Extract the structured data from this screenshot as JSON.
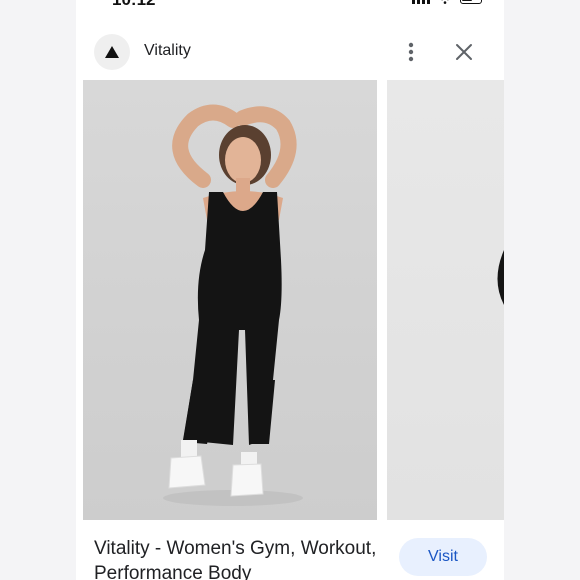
{
  "status_bar": {
    "time": "10:12"
  },
  "header": {
    "site_name": "Vitality",
    "logo_icon": "triangle-logo-icon",
    "more_icon": "more-vert-icon",
    "close_icon": "close-icon"
  },
  "result": {
    "title": "Vitality - Women's Gym, Workout, Performance Body",
    "visit_label": "Visit"
  },
  "colors": {
    "visit_bg": "#e8f0fe",
    "visit_text": "#1a56c4",
    "image_bg": "#d6d6d6"
  }
}
